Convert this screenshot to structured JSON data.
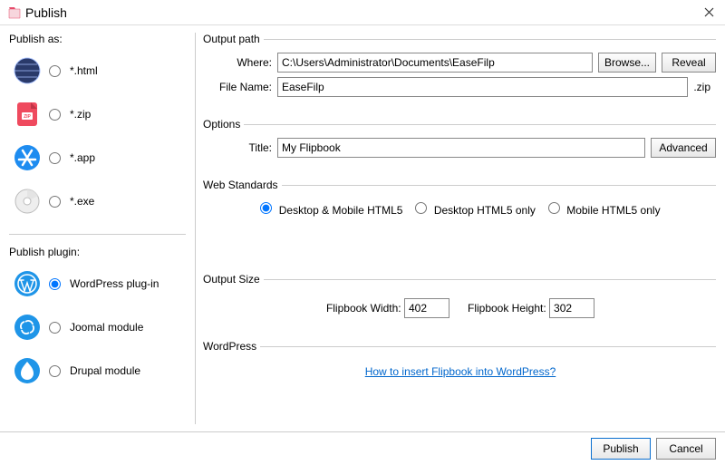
{
  "window": {
    "title": "Publish"
  },
  "publish_as": {
    "header": "Publish as:",
    "options": {
      "html": "*.html",
      "zip": "*.zip",
      "app": "*.app",
      "exe": "*.exe"
    },
    "selected": "html"
  },
  "publish_plugin": {
    "header": "Publish plugin:",
    "options": {
      "wordpress": "WordPress plug-in",
      "joomla": "Joomal module",
      "drupal": "Drupal module"
    },
    "selected": "wordpress"
  },
  "output_path": {
    "legend": "Output path",
    "where_label": "Where:",
    "where_value": "C:\\Users\\Administrator\\Documents\\EaseFilp",
    "file_label": "File Name:",
    "file_value": "EaseFilp",
    "file_ext": ".zip",
    "browse": "Browse...",
    "reveal": "Reveal"
  },
  "options": {
    "legend": "Options",
    "title_label": "Title:",
    "title_value": "My Flipbook",
    "advanced": "Advanced"
  },
  "web_standards": {
    "legend": "Web Standards",
    "desktop_mobile": "Desktop & Mobile HTML5",
    "desktop_only": "Desktop HTML5 only",
    "mobile_only": "Mobile HTML5 only",
    "selected": "desktop_mobile"
  },
  "output_size": {
    "legend": "Output Size",
    "width_label": "Flipbook Width:",
    "width_value": "402",
    "height_label": "Flipbook Height:",
    "height_value": "302"
  },
  "wordpress": {
    "legend": "WordPress",
    "link_text": "How to insert Flipbook into WordPress?"
  },
  "footer": {
    "publish": "Publish",
    "cancel": "Cancel"
  }
}
